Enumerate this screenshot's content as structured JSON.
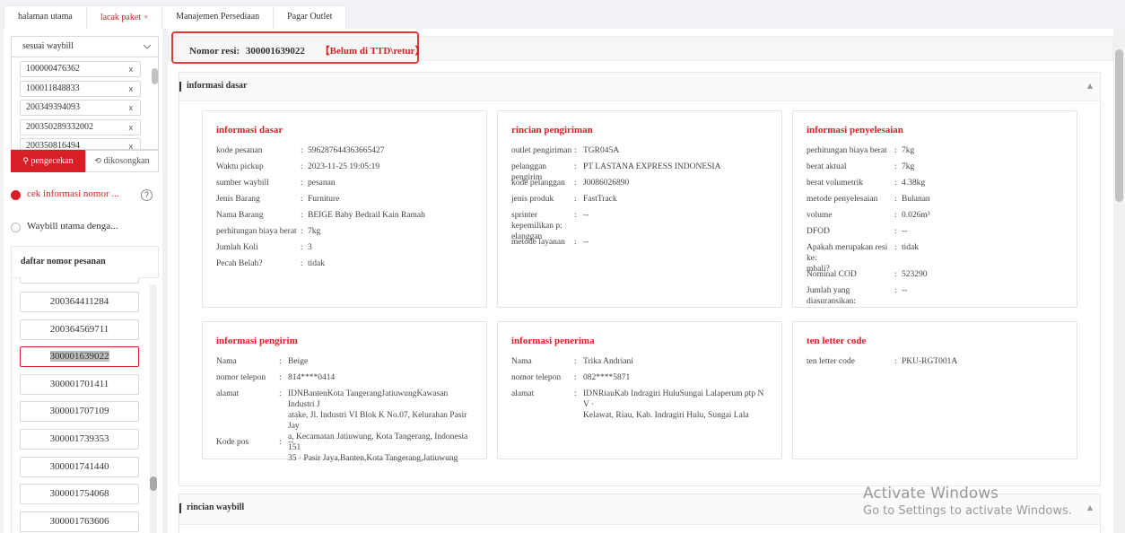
{
  "tabs": [
    {
      "label": "halaman utama",
      "active": false,
      "closable": false
    },
    {
      "label": "lacak paket",
      "active": true,
      "closable": true
    },
    {
      "label": "Manajemen Persediaan",
      "active": false,
      "closable": false
    },
    {
      "label": "Pagar Outlet",
      "active": false,
      "closable": false
    }
  ],
  "sidebar": {
    "filter_select": "sesuai waybill",
    "waybills": [
      "100000476362",
      "100011848833",
      "200349394093",
      "200350289332002",
      "200350816494"
    ],
    "search_button": "pengecekan",
    "clear_button": "dikosongkan",
    "radio_options": [
      {
        "label": "cek informasi nomor ...",
        "checked": true
      },
      {
        "label": "Waybill utama denga...",
        "checked": false
      }
    ],
    "order_list_title": "daftar nomor pesanan",
    "orders": [
      "200364411284",
      "200364569711",
      "300001639022",
      "300001701411",
      "300001707109",
      "300001739353",
      "300001741440",
      "300001754068",
      "300001763606"
    ],
    "selected_order": "300001639022"
  },
  "header": {
    "resi_label": "Nomor resi:",
    "resi_number": "300001639022",
    "status": "【Belum di TTD\\retur】"
  },
  "section_basic": {
    "title": "informasi dasar"
  },
  "section_waybill": {
    "title": "rincian waybill"
  },
  "card_basic": {
    "title": "informasi dasar",
    "rows": [
      {
        "k": "kode pesanan",
        "v": "596287644363665427"
      },
      {
        "k": "Waktu pickup",
        "v": "2023-11-25 19:05:19"
      },
      {
        "k": "sumber waybill",
        "v": "pesanan"
      },
      {
        "k": "Jenis Barang",
        "v": "Furniture"
      },
      {
        "k": "Nama Barang",
        "v": "BEIGE Baby Bedrail Kain Ramah"
      },
      {
        "k": "perhitungan biaya berat",
        "v": "7kg"
      },
      {
        "k": "Jumlah Koli",
        "v": "3"
      },
      {
        "k": "Pecah Belah?",
        "v": "tidak"
      }
    ]
  },
  "card_shipping": {
    "title": "rincian pengiriman",
    "rows": [
      {
        "k": "outlet pengiriman",
        "v": "TGR045A"
      },
      {
        "k": "pelanggan pengirim",
        "v": "PT LASTANA EXPRESS INDONESIA"
      },
      {
        "k": "kode pelanggan",
        "v": "J0086026890"
      },
      {
        "k": "jenis produk",
        "v": "FastTrack"
      },
      {
        "k": "sprinter kepemilikan p:elanggan",
        "k1": "sprinter kepemilikan p:",
        "k2": "elanggan",
        "v": "--"
      },
      {
        "k": "metode layanan",
        "v": "--"
      }
    ]
  },
  "card_settlement": {
    "title": "informasi penyelesaian",
    "rows": [
      {
        "k": "perhitungan biaya berat",
        "v": "7kg"
      },
      {
        "k": "berat aktual",
        "v": "7kg"
      },
      {
        "k": "berat volumetrik",
        "v": "4.38kg"
      },
      {
        "k": "metode penyelesaian",
        "v": "Bulanan"
      },
      {
        "k": "volume",
        "v": "0.026m³"
      },
      {
        "k": "DFOD",
        "v": "--"
      },
      {
        "k": "Apakah merupakan resi ke:mbali?",
        "k1": "Apakah merupakan resi ke:",
        "k2": "mbali?",
        "v": "tidak"
      },
      {
        "k": "Nominal COD",
        "v": "523290"
      },
      {
        "k": "Jumlah yang diasuransikan:",
        "v": "--"
      }
    ]
  },
  "card_sender": {
    "title": "informasi pengirim",
    "name_label": "Nama",
    "name": "Beige",
    "phone_label": "nomor telepon",
    "phone": "814****0414",
    "address_label": "alamat",
    "address_lines": [
      "IDNBantenKota TangerangJatiuwungKawasan Industri J",
      "atake, Jl. Industri VI Blok K No.07, Kelurahan Pasir Jay",
      "a, Kecamatan Jatiuwung, Kota Tangerang, Indonesia 151",
      "35 · Pasir Jaya,Banten,Kota Tangerang,Jatiuwung"
    ],
    "postal_label": "Kode pos",
    "postal": "--"
  },
  "card_receiver": {
    "title": "informasi penerima",
    "name_label": "Nama",
    "name": "Trika Andriani",
    "phone_label": "nomor telepon",
    "phone": "082****5871",
    "address_label": "alamat",
    "address_lines": [
      "IDNRiauKab Indragiri HuluSungai Lalaperum ptp N V ·",
      "Kelawat, Riau, Kab. Indragiri Hulu, Sungai Lala"
    ]
  },
  "card_letter": {
    "title": "ten letter code",
    "label": "ten letter code",
    "value": "PKU-RGT001A"
  },
  "windows_notice": {
    "line1": "Activate Windows",
    "line2": "Go to Settings to activate Windows."
  },
  "colors": {
    "accent": "#d91f26",
    "highlight_box": "#e53935"
  }
}
